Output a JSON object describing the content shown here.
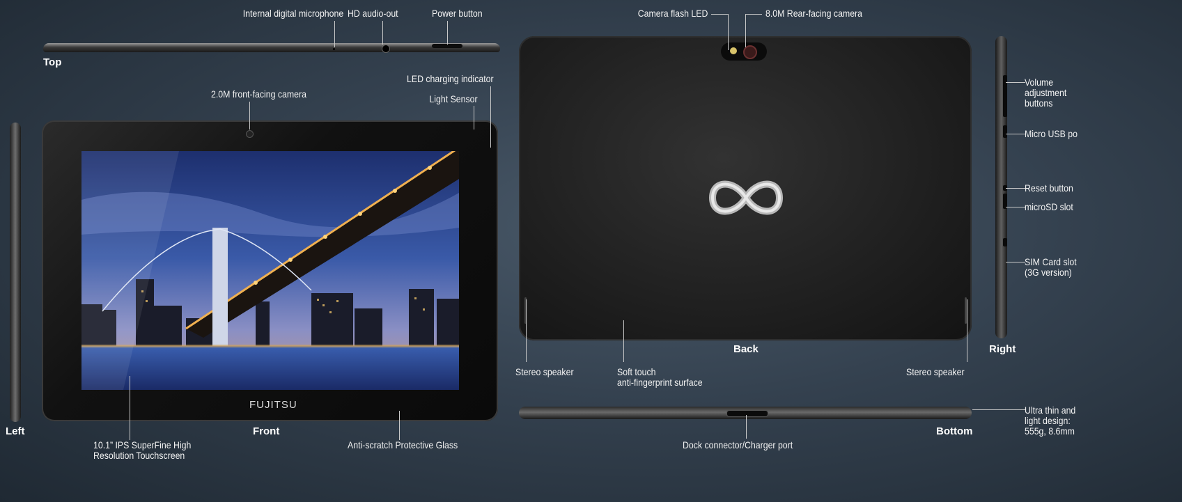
{
  "views": {
    "top": "Top",
    "left": "Left",
    "front": "Front",
    "back": "Back",
    "right": "Right",
    "bottom": "Bottom"
  },
  "callouts": {
    "microphone": "Internal digital microphone",
    "audio_out": "HD audio-out",
    "power": "Power button",
    "led_charging": "LED charging indicator",
    "light_sensor": "Light Sensor",
    "front_camera": "2.0M front-facing camera",
    "touchscreen": "10.1” IPS SuperFine High\nResolution Touchscreen",
    "glass": "Anti-scratch Protective Glass",
    "flash": "Camera flash LED",
    "rear_camera": "8.0M Rear-facing camera",
    "speaker_left": "Stereo speaker",
    "speaker_right": "Stereo speaker",
    "soft_touch": "Soft touch\nanti-fingerprint surface",
    "dock": "Dock connector/Charger port",
    "volume": "Volume\nadjustment\nbuttons",
    "usb": "Micro USB po",
    "reset": "Reset button",
    "microsd": "microSD slot",
    "sim": "SIM Card slot\n(3G version)",
    "ultra": "Ultra thin and\nlight design:\n555g, 8.6mm"
  },
  "brand": "FUJITSU"
}
